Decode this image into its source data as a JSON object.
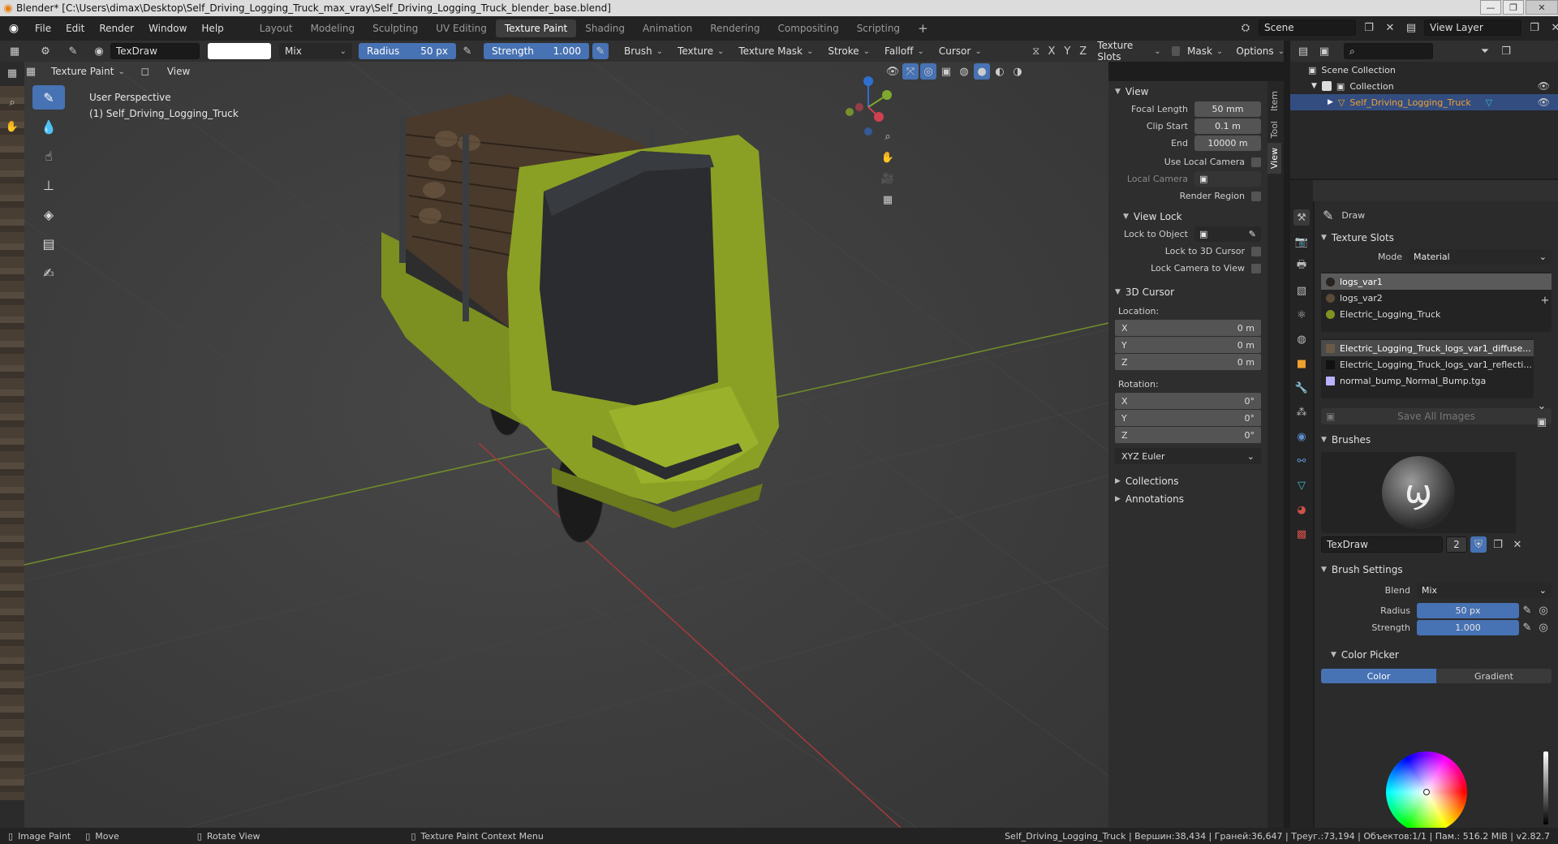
{
  "titlebar": {
    "title": "Blender* [C:\\Users\\dimax\\Desktop\\Self_Driving_Logging_Truck_max_vray\\Self_Driving_Logging_Truck_blender_base.blend]"
  },
  "menu": [
    "File",
    "Edit",
    "Render",
    "Window",
    "Help"
  ],
  "workspaces": [
    "Layout",
    "Modeling",
    "Sculpting",
    "UV Editing",
    "Texture Paint",
    "Shading",
    "Animation",
    "Rendering",
    "Compositing",
    "Scripting"
  ],
  "active_workspace": "Texture Paint",
  "scene": {
    "name": "Scene",
    "view_layer": "View Layer"
  },
  "header": {
    "brush_name": "TexDraw",
    "blend": "Mix",
    "radius_label": "Radius",
    "radius_value": "50 px",
    "strength_label": "Strength",
    "strength_value": "1.000",
    "menus": [
      "Brush",
      "Texture",
      "Texture Mask",
      "Stroke",
      "Falloff",
      "Cursor"
    ],
    "axes": [
      "X",
      "Y",
      "Z"
    ],
    "texture_slots": "Texture Slots",
    "mask": "Mask",
    "options": "Options"
  },
  "subheader": {
    "mode": "Texture Paint",
    "view": "View"
  },
  "viewport": {
    "perspective": "User Perspective",
    "object": "(1) Self_Driving_Logging_Truck"
  },
  "npanel": {
    "tabs": [
      "Item",
      "Tool",
      "View"
    ],
    "view_section": "View",
    "focal_length_label": "Focal Length",
    "focal_length": "50 mm",
    "clip_start_label": "Clip Start",
    "clip_start": "0.1 m",
    "end_label": "End",
    "end": "10000 m",
    "use_local_camera": "Use Local Camera",
    "local_camera": "Local Camera",
    "render_region": "Render Region",
    "view_lock": "View Lock",
    "lock_to_object": "Lock to Object",
    "lock_to_3d_cursor": "Lock to 3D Cursor",
    "lock_camera_to_view": "Lock Camera to View",
    "cursor_section": "3D Cursor",
    "location_label": "Location:",
    "location": [
      {
        "axis": "X",
        "value": "0 m"
      },
      {
        "axis": "Y",
        "value": "0 m"
      },
      {
        "axis": "Z",
        "value": "0 m"
      }
    ],
    "rotation_label": "Rotation:",
    "rotation": [
      {
        "axis": "X",
        "value": "0°"
      },
      {
        "axis": "Y",
        "value": "0°"
      },
      {
        "axis": "Z",
        "value": "0°"
      }
    ],
    "rotation_mode": "XYZ Euler",
    "collections": "Collections",
    "annotations": "Annotations"
  },
  "outliner": {
    "scene_collection": "Scene Collection",
    "collection": "Collection",
    "object": "Self_Driving_Logging_Truck"
  },
  "properties": {
    "tool_name": "Draw",
    "texture_slots_title": "Texture Slots",
    "mode_label": "Mode",
    "mode_value": "Material",
    "materials": [
      "logs_var1",
      "logs_var2",
      "Electric_Logging_Truck"
    ],
    "images": [
      "Electric_Logging_Truck_logs_var1_diffuse...",
      "Electric_Logging_Truck_logs_var1_reflecti...",
      "normal_bump_Normal_Bump.tga"
    ],
    "save_all_images": "Save All Images",
    "brushes_title": "Brushes",
    "brush_name": "TexDraw",
    "brush_users": "2",
    "brush_settings_title": "Brush Settings",
    "blend_label": "Blend",
    "blend_value": "Mix",
    "radius_label": "Radius",
    "radius_value": "50 px",
    "strength_label": "Strength",
    "strength_value": "1.000",
    "color_picker_title": "Color Picker",
    "color_tab": "Color",
    "gradient_tab": "Gradient"
  },
  "statusbar": {
    "image_paint": "Image Paint",
    "move": "Move",
    "rotate_view": "Rotate View",
    "context_menu": "Texture Paint Context Menu",
    "stats": "Self_Driving_Logging_Truck | Вершин:38,434 | Граней:36,647 | Треуг.:73,194 | Объектов:1/1 | Пам.: 516.2 MiB | v2.82.7"
  },
  "colors": {
    "accent": "#4772b3",
    "truck_green": "#8aa024",
    "selection": "#334d80"
  }
}
